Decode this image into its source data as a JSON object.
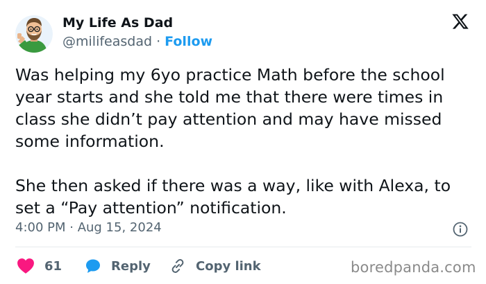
{
  "author": {
    "name": "My Life As Dad",
    "handle": "@milifeasdad",
    "separator": "·",
    "follow_label": "Follow"
  },
  "post": {
    "paragraphs": [
      "Was helping my 6yo practice Math before the school year starts and she told me that there were times in class she didn’t pay attention and may have missed some information.",
      "She then asked if there was a way, like with Alexa, to set a “Pay attention” notification."
    ],
    "timestamp": "4:00 PM · Aug 15, 2024"
  },
  "actions": {
    "likes_count": "61",
    "reply_label": "Reply",
    "copy_link_label": "Copy link"
  },
  "watermark": "boredpanda.com",
  "colors": {
    "like": "#f91880",
    "reply": "#1d9bf0",
    "follow": "#1d9bf0",
    "muted": "#536471",
    "text": "#0f1419"
  },
  "icons": {
    "platform": "x-logo-icon",
    "avatar": "cartoon-dad-avatar",
    "like": "heart-icon",
    "reply": "speech-bubble-icon",
    "copy": "link-icon",
    "info": "info-icon"
  }
}
